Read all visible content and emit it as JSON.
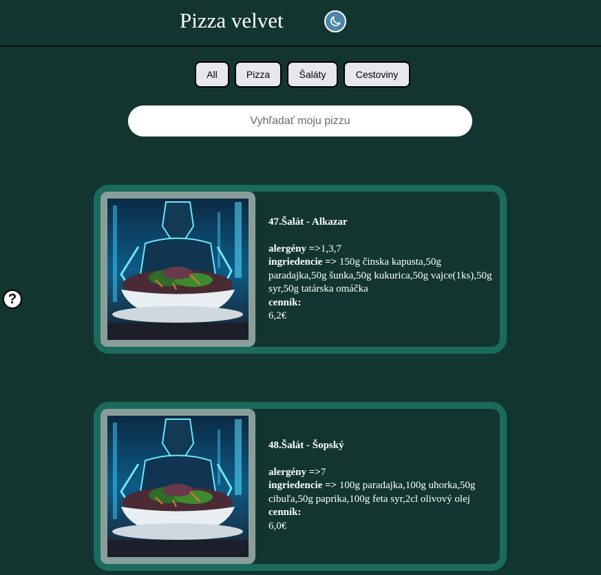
{
  "header": {
    "title": "Pizza velvet",
    "theme_icon": "moon-icon"
  },
  "filters": [
    "All",
    "Pizza",
    "Šaláty",
    "Cestoviny"
  ],
  "search": {
    "placeholder": "Vyhľadať moju pizzu",
    "value": ""
  },
  "help": {
    "label": "?"
  },
  "labels": {
    "allergens": "alergény =>",
    "ingredients": "ingriedencie =>",
    "price": "cenník:"
  },
  "items": [
    {
      "name": "47.Šalát - Alkazar",
      "allergens": "1,3,7",
      "ingredients": " 150g činska kapusta,50g paradajka,50g šunka,50g kukurica,50g vajce(1ks),50g syr,50g tatárska omáčka",
      "price": "6,2€"
    },
    {
      "name": "48.Šalát - Šopský",
      "allergens": "7",
      "ingredients": " 100g paradajka,100g uhorka,50g cibuľa,50g paprika,100g feta syr,2cl olivový olej",
      "price": "6,0€"
    }
  ]
}
